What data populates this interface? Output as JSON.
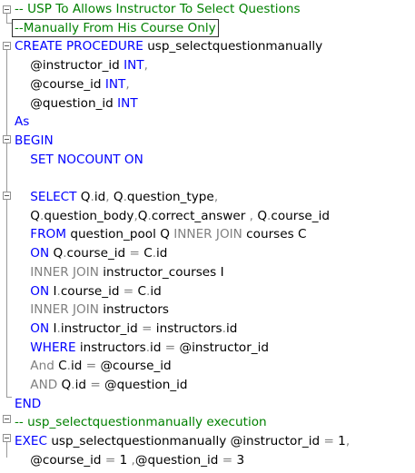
{
  "lines": [
    {
      "parts": [
        {
          "text": "-- USP To Allows Instructor To Select Questions",
          "c": "green"
        }
      ]
    },
    {
      "parts": [
        {
          "text": "--Manually From His Course Only",
          "c": "green",
          "box": true
        }
      ]
    },
    {
      "parts": [
        {
          "text": "CREATE PROCEDURE ",
          "c": "ykw"
        },
        {
          "text": "usp_selectquestionmanually",
          "c": ""
        }
      ]
    },
    {
      "parts": [
        {
          "text": "    @instructor_id ",
          "c": ""
        },
        {
          "text": "INT",
          "c": "ykw"
        },
        {
          "text": ",",
          "c": "gray"
        }
      ]
    },
    {
      "parts": [
        {
          "text": "    @course_id ",
          "c": ""
        },
        {
          "text": "INT",
          "c": "ykw"
        },
        {
          "text": ",",
          "c": "gray"
        }
      ]
    },
    {
      "parts": [
        {
          "text": "    @question_id ",
          "c": ""
        },
        {
          "text": "INT",
          "c": "ykw"
        }
      ]
    },
    {
      "parts": [
        {
          "text": "As",
          "c": "ykw"
        }
      ]
    },
    {
      "parts": [
        {
          "text": "BEGIN",
          "c": "ykw"
        }
      ]
    },
    {
      "parts": [
        {
          "text": "    SET NOCOUNT ON",
          "c": "ykw"
        }
      ]
    },
    {
      "parts": [
        {
          "text": "",
          "c": ""
        }
      ]
    },
    {
      "parts": [
        {
          "text": "    SELECT ",
          "c": "ykw"
        },
        {
          "text": "Q",
          "c": ""
        },
        {
          "text": ".",
          "c": "gray"
        },
        {
          "text": "id",
          "c": ""
        },
        {
          "text": ", ",
          "c": "gray"
        },
        {
          "text": "Q",
          "c": ""
        },
        {
          "text": ".",
          "c": "gray"
        },
        {
          "text": "question_type",
          "c": ""
        },
        {
          "text": ",",
          "c": "gray"
        }
      ]
    },
    {
      "parts": [
        {
          "text": "    Q",
          "c": ""
        },
        {
          "text": ".",
          "c": "gray"
        },
        {
          "text": "question_body",
          "c": ""
        },
        {
          "text": ",",
          "c": "gray"
        },
        {
          "text": "Q",
          "c": ""
        },
        {
          "text": ".",
          "c": "gray"
        },
        {
          "text": "correct_answer ",
          "c": ""
        },
        {
          "text": ", ",
          "c": "gray"
        },
        {
          "text": "Q",
          "c": ""
        },
        {
          "text": ".",
          "c": "gray"
        },
        {
          "text": "course_id",
          "c": ""
        }
      ]
    },
    {
      "parts": [
        {
          "text": "    FROM ",
          "c": "ykw"
        },
        {
          "text": "question_pool Q ",
          "c": ""
        },
        {
          "text": "INNER JOIN ",
          "c": "gray"
        },
        {
          "text": "courses C",
          "c": ""
        }
      ]
    },
    {
      "parts": [
        {
          "text": "    ON ",
          "c": "ykw"
        },
        {
          "text": "Q",
          "c": ""
        },
        {
          "text": ".",
          "c": "gray"
        },
        {
          "text": "course_id ",
          "c": ""
        },
        {
          "text": "= ",
          "c": "gray"
        },
        {
          "text": "C",
          "c": ""
        },
        {
          "text": ".",
          "c": "gray"
        },
        {
          "text": "id",
          "c": ""
        }
      ]
    },
    {
      "parts": [
        {
          "text": "    INNER JOIN ",
          "c": "gray"
        },
        {
          "text": "instructor_courses I",
          "c": ""
        }
      ]
    },
    {
      "parts": [
        {
          "text": "    ON ",
          "c": "ykw"
        },
        {
          "text": "I",
          "c": ""
        },
        {
          "text": ".",
          "c": "gray"
        },
        {
          "text": "course_id ",
          "c": ""
        },
        {
          "text": "= ",
          "c": "gray"
        },
        {
          "text": "C",
          "c": ""
        },
        {
          "text": ".",
          "c": "gray"
        },
        {
          "text": "id",
          "c": ""
        }
      ]
    },
    {
      "parts": [
        {
          "text": "    INNER JOIN ",
          "c": "gray"
        },
        {
          "text": "instructors",
          "c": ""
        }
      ]
    },
    {
      "parts": [
        {
          "text": "    ON ",
          "c": "ykw"
        },
        {
          "text": "I",
          "c": ""
        },
        {
          "text": ".",
          "c": "gray"
        },
        {
          "text": "instructor_id ",
          "c": ""
        },
        {
          "text": "= ",
          "c": "gray"
        },
        {
          "text": "instructors",
          "c": ""
        },
        {
          "text": ".",
          "c": "gray"
        },
        {
          "text": "id",
          "c": ""
        }
      ]
    },
    {
      "parts": [
        {
          "text": "    WHERE ",
          "c": "ykw"
        },
        {
          "text": "instructors",
          "c": ""
        },
        {
          "text": ".",
          "c": "gray"
        },
        {
          "text": "id ",
          "c": ""
        },
        {
          "text": "= ",
          "c": "gray"
        },
        {
          "text": "@instructor_id",
          "c": ""
        }
      ]
    },
    {
      "parts": [
        {
          "text": "    And ",
          "c": "gray"
        },
        {
          "text": "C",
          "c": ""
        },
        {
          "text": ".",
          "c": "gray"
        },
        {
          "text": "id ",
          "c": ""
        },
        {
          "text": "= ",
          "c": "gray"
        },
        {
          "text": "@course_id",
          "c": ""
        }
      ]
    },
    {
      "parts": [
        {
          "text": "    AND ",
          "c": "gray"
        },
        {
          "text": "Q",
          "c": ""
        },
        {
          "text": ".",
          "c": "gray"
        },
        {
          "text": "id ",
          "c": ""
        },
        {
          "text": "= ",
          "c": "gray"
        },
        {
          "text": "@question_id",
          "c": ""
        }
      ]
    },
    {
      "parts": [
        {
          "text": "END",
          "c": "ykw"
        }
      ]
    },
    {
      "parts": [
        {
          "text": "-- usp_selectquestionmanually execution",
          "c": "green"
        }
      ]
    },
    {
      "parts": [
        {
          "text": "EXEC ",
          "c": "ykw"
        },
        {
          "text": "usp_selectquestionmanually ",
          "c": ""
        },
        {
          "text": "@instructor_id ",
          "c": ""
        },
        {
          "text": "= ",
          "c": "gray"
        },
        {
          "text": "1",
          "c": ""
        },
        {
          "text": ",",
          "c": "gray"
        }
      ]
    },
    {
      "parts": [
        {
          "text": "    @course_id ",
          "c": ""
        },
        {
          "text": "= ",
          "c": "gray"
        },
        {
          "text": "1 ",
          "c": ""
        },
        {
          "text": ",",
          "c": "gray"
        },
        {
          "text": "@question_id ",
          "c": ""
        },
        {
          "text": "= ",
          "c": "gray"
        },
        {
          "text": "3",
          "c": ""
        }
      ]
    }
  ],
  "colors": {
    "keyword": "#0000ff",
    "operator": "#808080",
    "comment": "#008000",
    "text": "#000000"
  }
}
